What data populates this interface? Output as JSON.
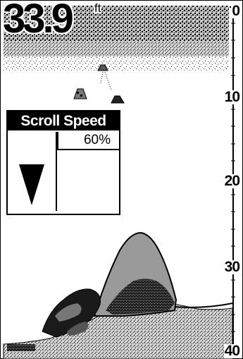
{
  "readout": {
    "depth_value": "33.9",
    "depth_unit": "ft"
  },
  "depth_scale": {
    "labels": [
      "0",
      "10",
      "20",
      "30",
      "40"
    ]
  },
  "scroll_speed": {
    "title": "Scroll Speed",
    "value": "60%",
    "level_fraction": 0.6
  },
  "colors": {
    "background": "#ffffff",
    "foreground": "#000000",
    "structure_gray": "#9a9a9a",
    "bottom_light": "#c8c8c8"
  },
  "icons": {
    "fish": "fish-icon",
    "speed_arrow": "triangle-down-icon"
  }
}
